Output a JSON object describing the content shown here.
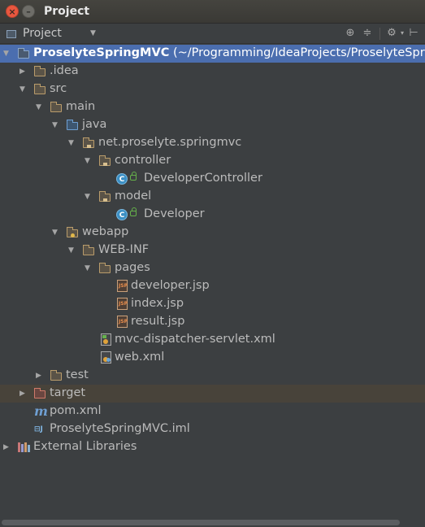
{
  "window": {
    "title": "Project"
  },
  "toolbar": {
    "view_label": "Project"
  },
  "tree": {
    "root_name": "ProselyteSpringMVC",
    "root_path": "(~/Programming/IdeaProjects/ProselyteSpringMVC)",
    "items": [
      ".idea",
      "src",
      "main",
      "java",
      "net.proselyte.springmvc",
      "controller",
      "DeveloperController",
      "model",
      "Developer",
      "webapp",
      "WEB-INF",
      "pages",
      "developer.jsp",
      "index.jsp",
      "result.jsp",
      "mvc-dispatcher-servlet.xml",
      "web.xml",
      "test",
      "target",
      "pom.xml",
      "ProselyteSpringMVC.iml",
      "External Libraries"
    ]
  },
  "colors": {
    "selection": "#4b6eaf",
    "background": "#3c3f41",
    "text": "#bbbbbb"
  }
}
